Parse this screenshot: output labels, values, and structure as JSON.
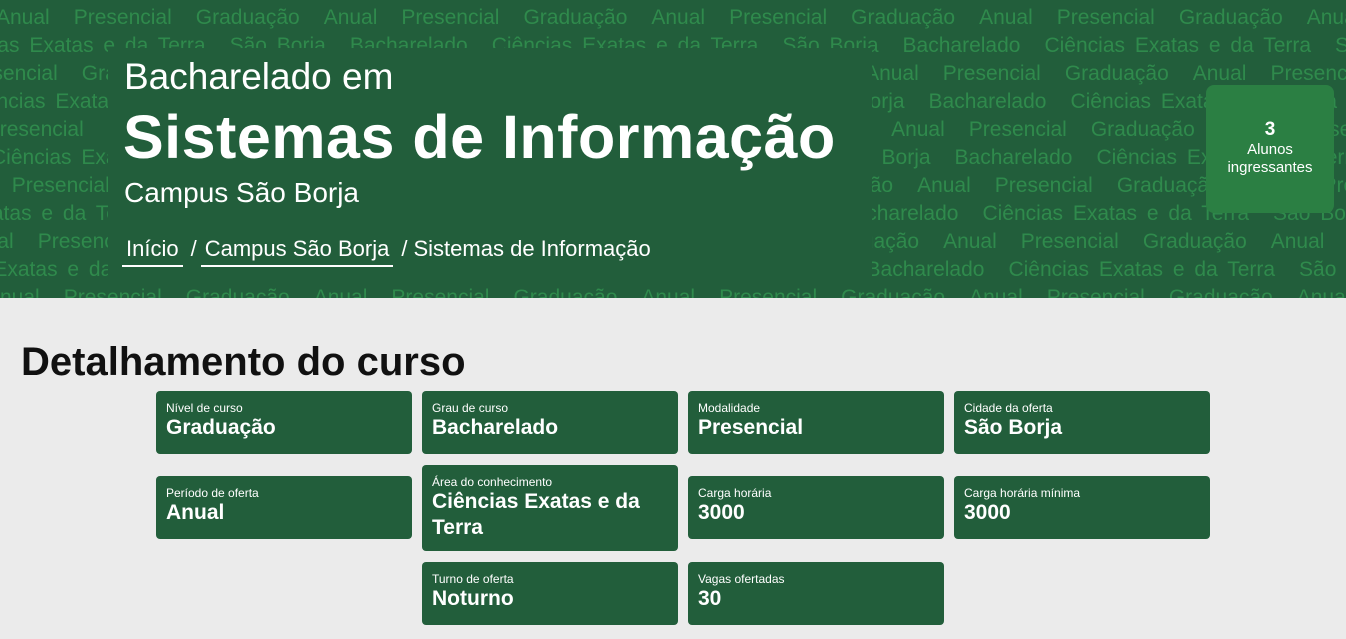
{
  "hero": {
    "pre_title": "Bacharelado em",
    "title": "Sistemas de Informação",
    "campus": "Campus São Borja",
    "breadcrumb": {
      "home": "Início",
      "campus": "Campus São Borja",
      "current": "Sistemas de Informação",
      "separator": "/"
    },
    "stat": {
      "number": "3",
      "label_line1": "Alunos",
      "label_line2": "ingressantes"
    },
    "pattern_words": [
      "Anual",
      "Bacharelado",
      "Presencial",
      "Ciências Exatas e da Terra",
      "Graduação",
      "São Borja"
    ]
  },
  "section": {
    "title": "Detalhamento do curso"
  },
  "cards": [
    {
      "label": "Nível de curso",
      "value": "Graduação"
    },
    {
      "label": "Grau de curso",
      "value": "Bacharelado"
    },
    {
      "label": "Modalidade",
      "value": "Presencial"
    },
    {
      "label": "Cidade da oferta",
      "value": "São Borja"
    },
    {
      "label": "Período de oferta",
      "value": "Anual"
    },
    {
      "label": "Área do conhecimento",
      "value": "Ciências Exatas e da Terra"
    },
    {
      "label": "Carga horária",
      "value": "3000"
    },
    {
      "label": "Carga horária mínima",
      "value": "3000"
    },
    {
      "label": "Turno de oferta",
      "value": "Noturno"
    },
    {
      "label": "Vagas ofertadas",
      "value": "30"
    }
  ],
  "colors": {
    "hero_bg": "#225e3b",
    "pattern_text": "#2f8a4c",
    "stat_bg": "#2b7f43",
    "card_bg": "#225e3b",
    "page_bg": "#ebebeb"
  }
}
